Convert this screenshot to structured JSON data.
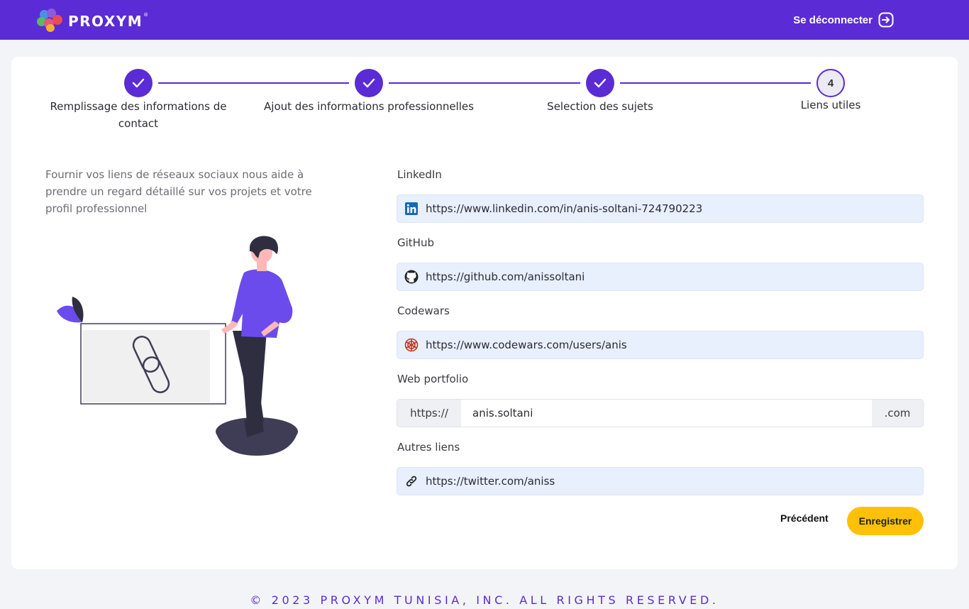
{
  "header": {
    "brand": "PROXYM",
    "brand_mark": "®",
    "logout_label": "Se déconnecter",
    "logout_icon": "logout-icon"
  },
  "stepper": {
    "steps": [
      {
        "label": "Remplissage des informations de contact",
        "status": "done"
      },
      {
        "label": "Ajout des informations professionnelles",
        "status": "done"
      },
      {
        "label": "Selection des sujets",
        "status": "done"
      },
      {
        "label": "Liens utiles",
        "status": "current",
        "number": "4"
      }
    ]
  },
  "intro": {
    "text": "Fournir vos liens de réseaux sociaux nous aide à prendre un regard détaillé sur vos projets et votre profil professionnel"
  },
  "form": {
    "linkedin": {
      "label": "LinkedIn",
      "value": "https://www.linkedin.com/in/anis-soltani-724790223",
      "icon": "linkedin-icon"
    },
    "github": {
      "label": "GitHub",
      "value": "https://github.com/anissoltani",
      "icon": "github-icon"
    },
    "codewars": {
      "label": "Codewars",
      "value": "https://www.codewars.com/users/anis",
      "icon": "codewars-icon"
    },
    "portfolio": {
      "label": "Web portfolio",
      "prefix": "https://",
      "value": "anis.soltani",
      "suffix": ".com"
    },
    "other": {
      "label": "Autres liens",
      "value": "https://twitter.com/aniss",
      "icon": "link-icon"
    }
  },
  "actions": {
    "previous_label": "Précédent",
    "save_label": "Enregistrer"
  },
  "footer": {
    "text": "© 2023 PROXYM TUNISIA, INC. ALL RIGHTS RESERVED."
  },
  "colors": {
    "primary": "#5b2bd6",
    "accent": "#ffc107",
    "input_bg": "#e8effd"
  }
}
